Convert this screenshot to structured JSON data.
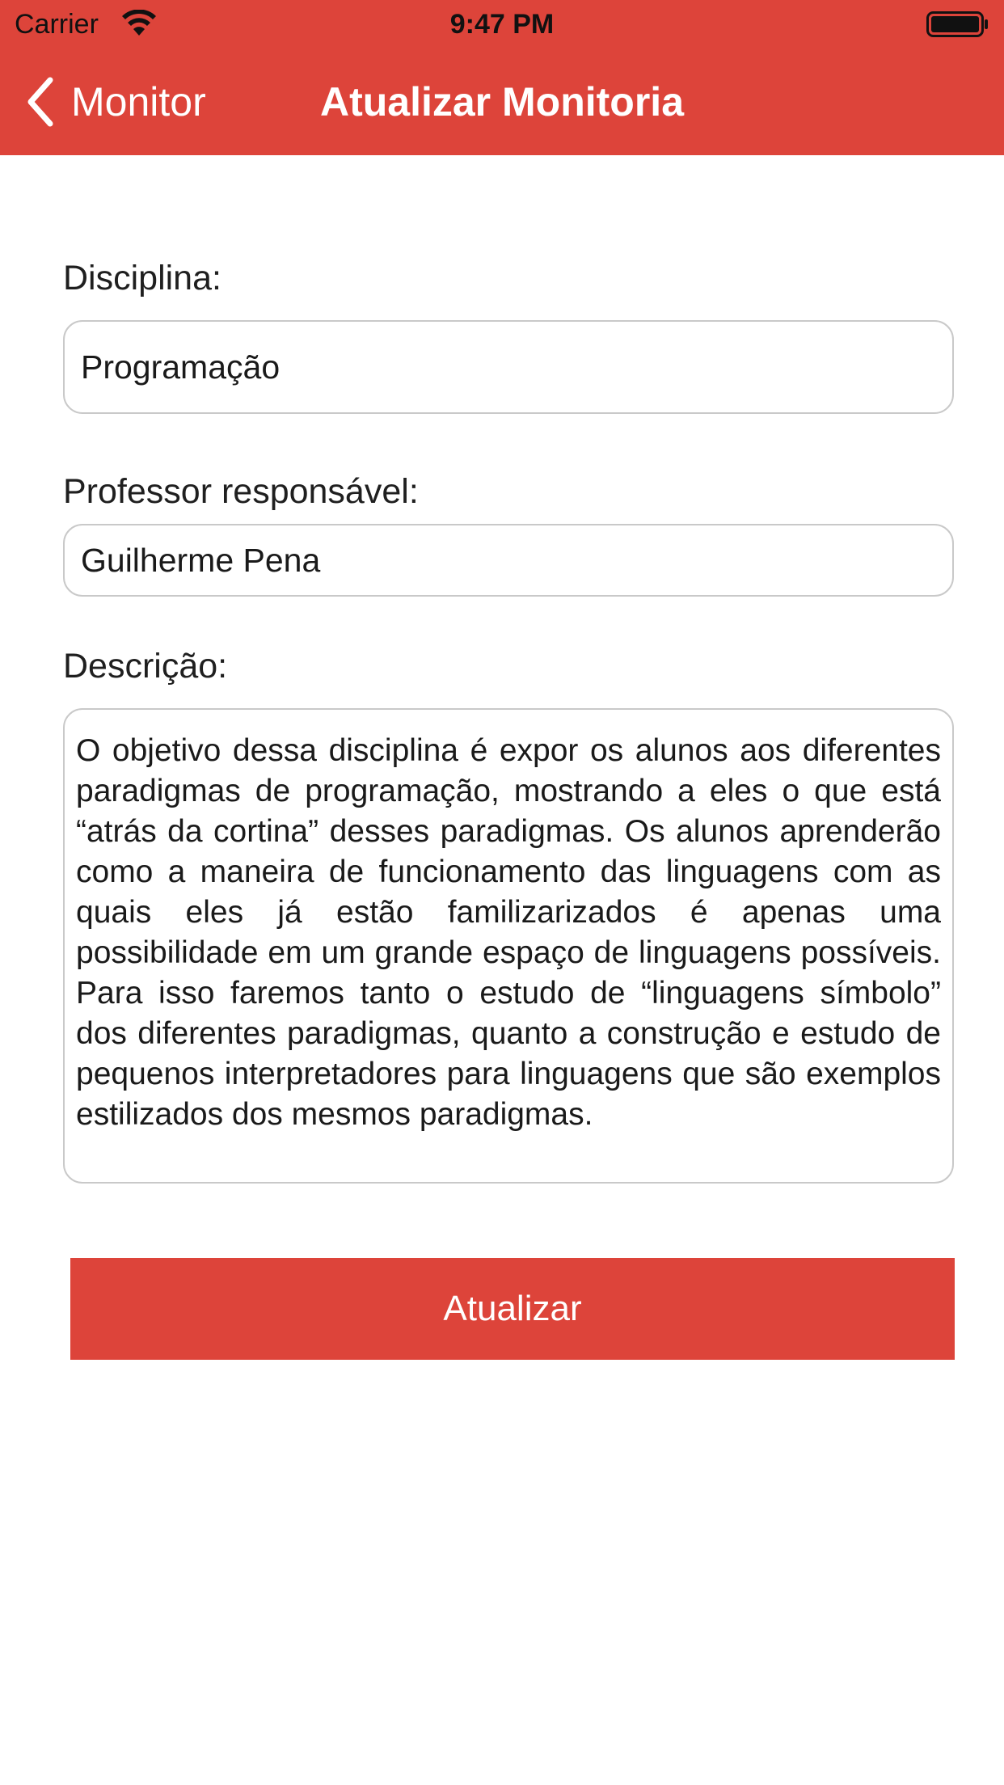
{
  "status_bar": {
    "carrier": "Carrier",
    "time": "9:47 PM"
  },
  "nav": {
    "back_label": "Monitor",
    "title": "Atualizar Monitoria"
  },
  "form": {
    "disciplina_label": "Disciplina:",
    "disciplina_value": "Programação",
    "professor_label": "Professor responsável:",
    "professor_value": "Guilherme Pena",
    "descricao_label": "Descrição:",
    "descricao_value": "O objetivo dessa disciplina é expor os alunos aos diferentes paradigmas de programação, mostrando a eles o que está “atrás da cortina” desses paradigmas. Os alunos aprenderão como a maneira de funcionamento das linguagens com as quais eles já estão familizarizados é apenas uma possibilidade em um grande espaço de linguagens possíveis. Para isso faremos tanto o estudo de “linguagens símbolo” dos diferentes paradigmas, quanto a construção e estudo de pequenos interpretadores para linguagens que são exemplos estilizados dos mesmos paradigmas.",
    "submit_label": "Atualizar"
  },
  "colors": {
    "accent": "#dd443a",
    "field_border": "#c9c9c9"
  },
  "icons": {
    "back": "chevron-left-icon",
    "wifi": "wifi-icon",
    "battery": "battery-icon"
  }
}
